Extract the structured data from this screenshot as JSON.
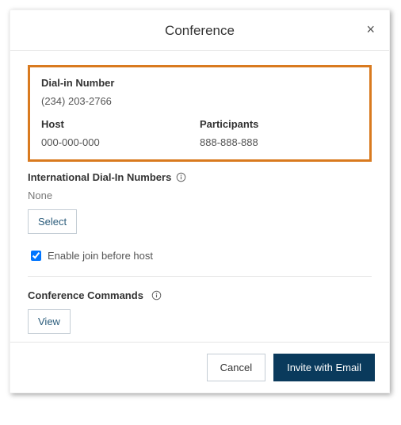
{
  "dialog": {
    "title": "Conference",
    "dialInLabel": "Dial-in Number",
    "dialInNumber": "(234) 203-2766",
    "hostLabel": "Host",
    "hostCode": "000-000-000",
    "participantsLabel": "Participants",
    "participantsCode": "888-888-888",
    "intlLabel": "International Dial-In Numbers",
    "intlValue": "None",
    "selectLabel": "Select",
    "enableJoinLabel": "Enable join before host",
    "commandsLabel": "Conference Commands",
    "viewLabel": "View",
    "cancelLabel": "Cancel",
    "inviteLabel": "Invite with Email"
  }
}
